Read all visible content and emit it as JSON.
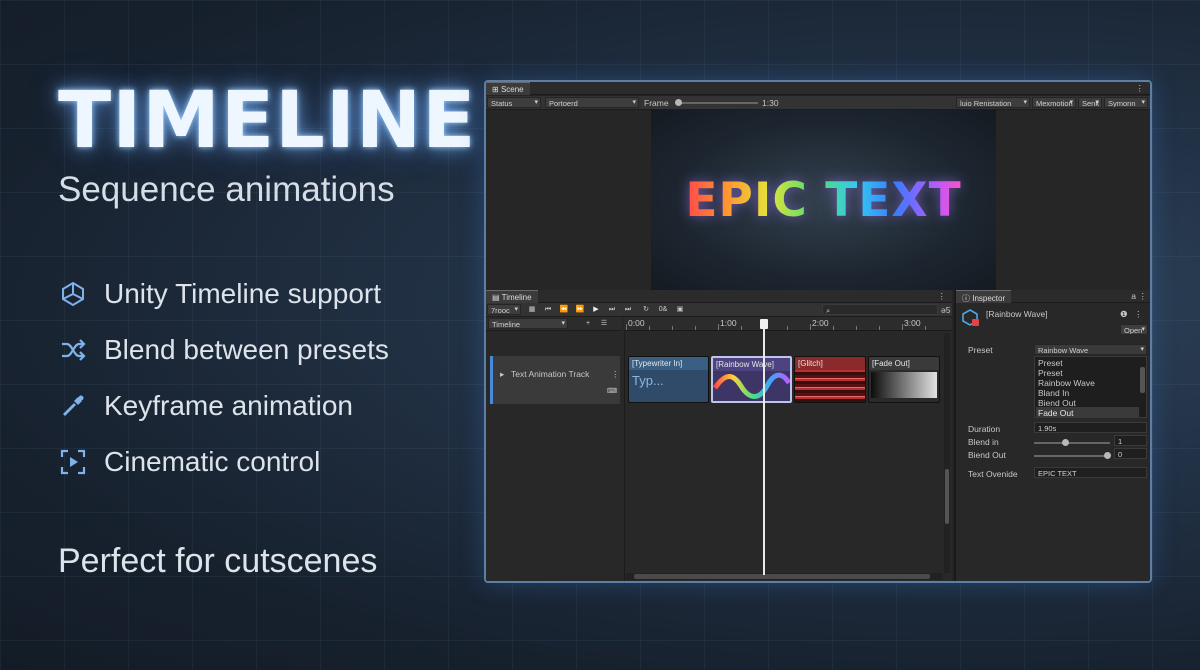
{
  "hero": {
    "title": "TIMELINE",
    "subtitle": "Sequence animations",
    "footer": "Perfect for cutscenes"
  },
  "features": [
    {
      "label": "Unity Timeline support",
      "icon": "unity-logo-icon"
    },
    {
      "label": "Blend between presets",
      "icon": "shuffle-icon"
    },
    {
      "label": "Keyframe animation",
      "icon": "keyframe-pen-icon"
    },
    {
      "label": "Cinematic control",
      "icon": "play-frame-icon"
    }
  ],
  "scene": {
    "tab": "Scene",
    "shading": "Status",
    "view": "Portoerd",
    "frame_label": "Frame",
    "frame_value": "1:30",
    "right_dd": "luio Renistation",
    "b1": "Mexmotion",
    "b2": "Senk",
    "b3": "Symonn",
    "preview_text": "EPIC TEXT"
  },
  "timeline": {
    "tab": "Timeline",
    "mode": "7rooc",
    "asset": "Timeline",
    "counter": "ǝ5",
    "btn_ext": "0&",
    "ruler": [
      "0:00",
      "1:00",
      "2:00",
      "3:00"
    ],
    "track": "Text Animation Track",
    "clips": [
      {
        "label": "[Typewriter In]",
        "content": "Typ..."
      },
      {
        "label": "[Rainbow Wave]"
      },
      {
        "label": "[Glitch]"
      },
      {
        "label": "[Fade Out]"
      }
    ]
  },
  "inspector": {
    "tab": "Inspector",
    "name": "[Rainbow Wave]",
    "open": "Open",
    "preset_label": "Preset",
    "preset_value": "Rainbow Wave",
    "options": [
      "Preset",
      "Preset",
      "Rainbow Wave",
      "Bland In",
      "Biend Out",
      "Fade Out"
    ],
    "duration_label": "Duration",
    "duration": "1.90s",
    "blend_in_label": "Blend in",
    "blend_in": "1",
    "blend_out_label": "Biend Out",
    "blend_out": "0",
    "text_label": "Text Ovenide",
    "text_value": "EPIC TEXT"
  }
}
